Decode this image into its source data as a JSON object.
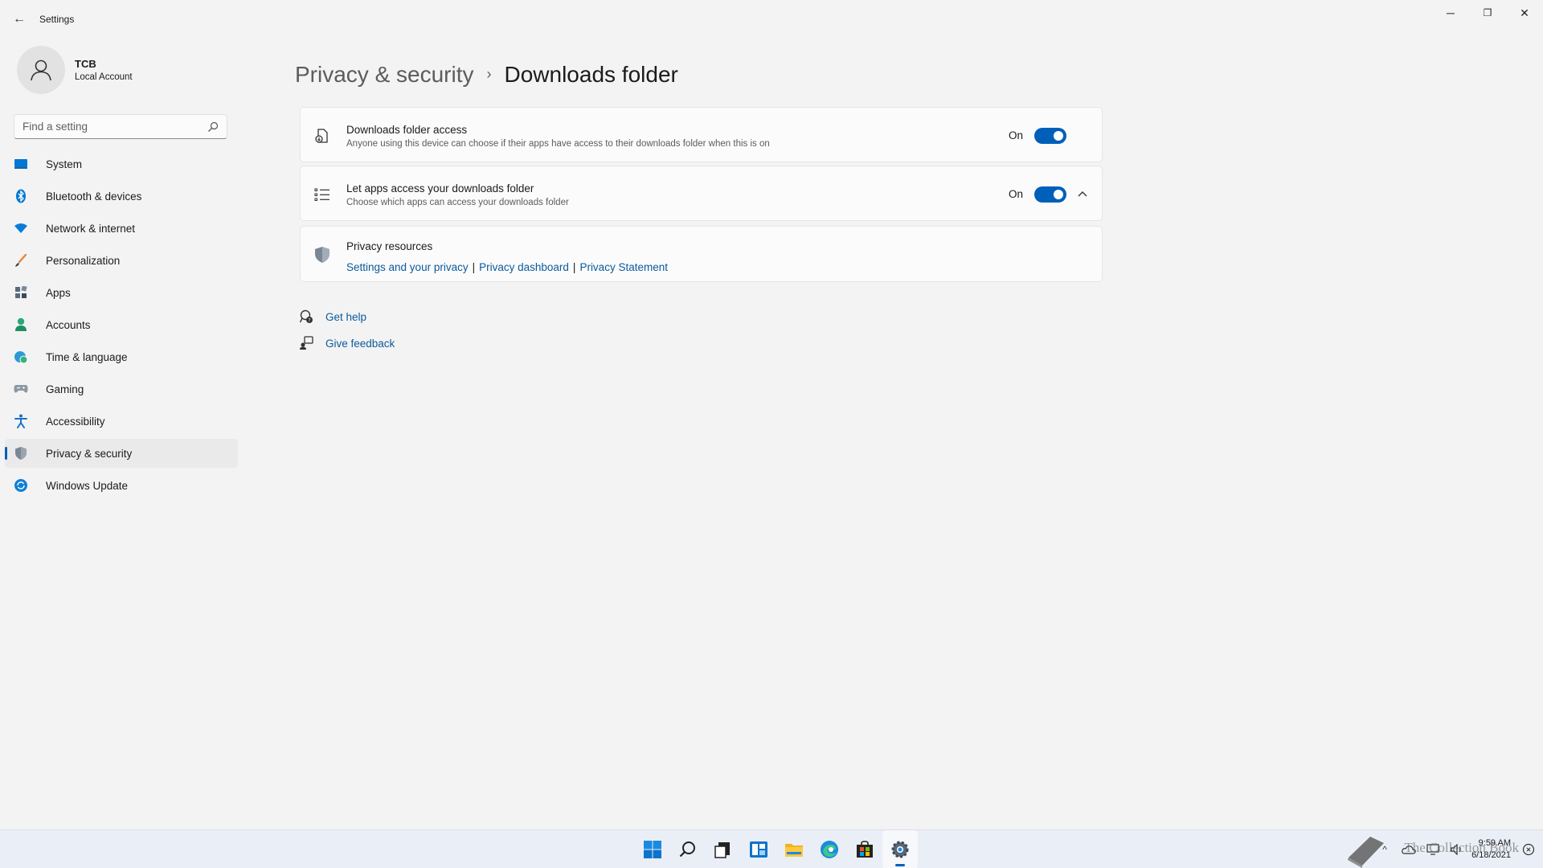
{
  "window": {
    "back_glyph": "←",
    "title": "Settings",
    "minimize_glyph": "─",
    "maximize_glyph": "❐",
    "close_glyph": "✕"
  },
  "profile": {
    "name": "TCB",
    "account_type": "Local Account"
  },
  "search": {
    "placeholder": "Find a setting"
  },
  "nav": {
    "items": [
      {
        "label": "System",
        "icon": "system-icon"
      },
      {
        "label": "Bluetooth & devices",
        "icon": "bluetooth-icon"
      },
      {
        "label": "Network & internet",
        "icon": "wifi-icon"
      },
      {
        "label": "Personalization",
        "icon": "brush-icon"
      },
      {
        "label": "Apps",
        "icon": "apps-icon"
      },
      {
        "label": "Accounts",
        "icon": "person-icon"
      },
      {
        "label": "Time & language",
        "icon": "globe-clock-icon"
      },
      {
        "label": "Gaming",
        "icon": "gamepad-icon"
      },
      {
        "label": "Accessibility",
        "icon": "accessibility-icon"
      },
      {
        "label": "Privacy & security",
        "icon": "shield-icon",
        "active": true
      },
      {
        "label": "Windows Update",
        "icon": "update-icon"
      }
    ]
  },
  "breadcrumb": {
    "parent": "Privacy & security",
    "separator": "›",
    "current": "Downloads folder"
  },
  "cards": {
    "downloads_access": {
      "title": "Downloads folder access",
      "description": "Anyone using this device can choose if their apps have access to their downloads folder when this is on",
      "state_label": "On",
      "on": true
    },
    "let_apps": {
      "title": "Let apps access your downloads folder",
      "description": "Choose which apps can access your downloads folder",
      "state_label": "On",
      "on": true,
      "expanded": true
    },
    "privacy_resources": {
      "title": "Privacy resources",
      "links": [
        "Settings and your privacy",
        "Privacy dashboard",
        "Privacy Statement"
      ],
      "separator": "|"
    }
  },
  "help": {
    "get_help": "Get help",
    "give_feedback": "Give feedback"
  },
  "taskbar": {
    "apps": [
      "start-icon",
      "search-icon",
      "task-view-icon",
      "widgets-icon",
      "file-explorer-icon",
      "edge-icon",
      "store-icon",
      "settings-icon"
    ],
    "active_app": "settings-icon",
    "tray_chevron": "^",
    "time": "9:59 AM",
    "date": "6/18/2021",
    "watermark": "The Collection Book"
  },
  "colors": {
    "accent": "#005fb8",
    "link": "#0a5a9c",
    "background": "#f3f3f3",
    "card": "#fbfbfb"
  }
}
